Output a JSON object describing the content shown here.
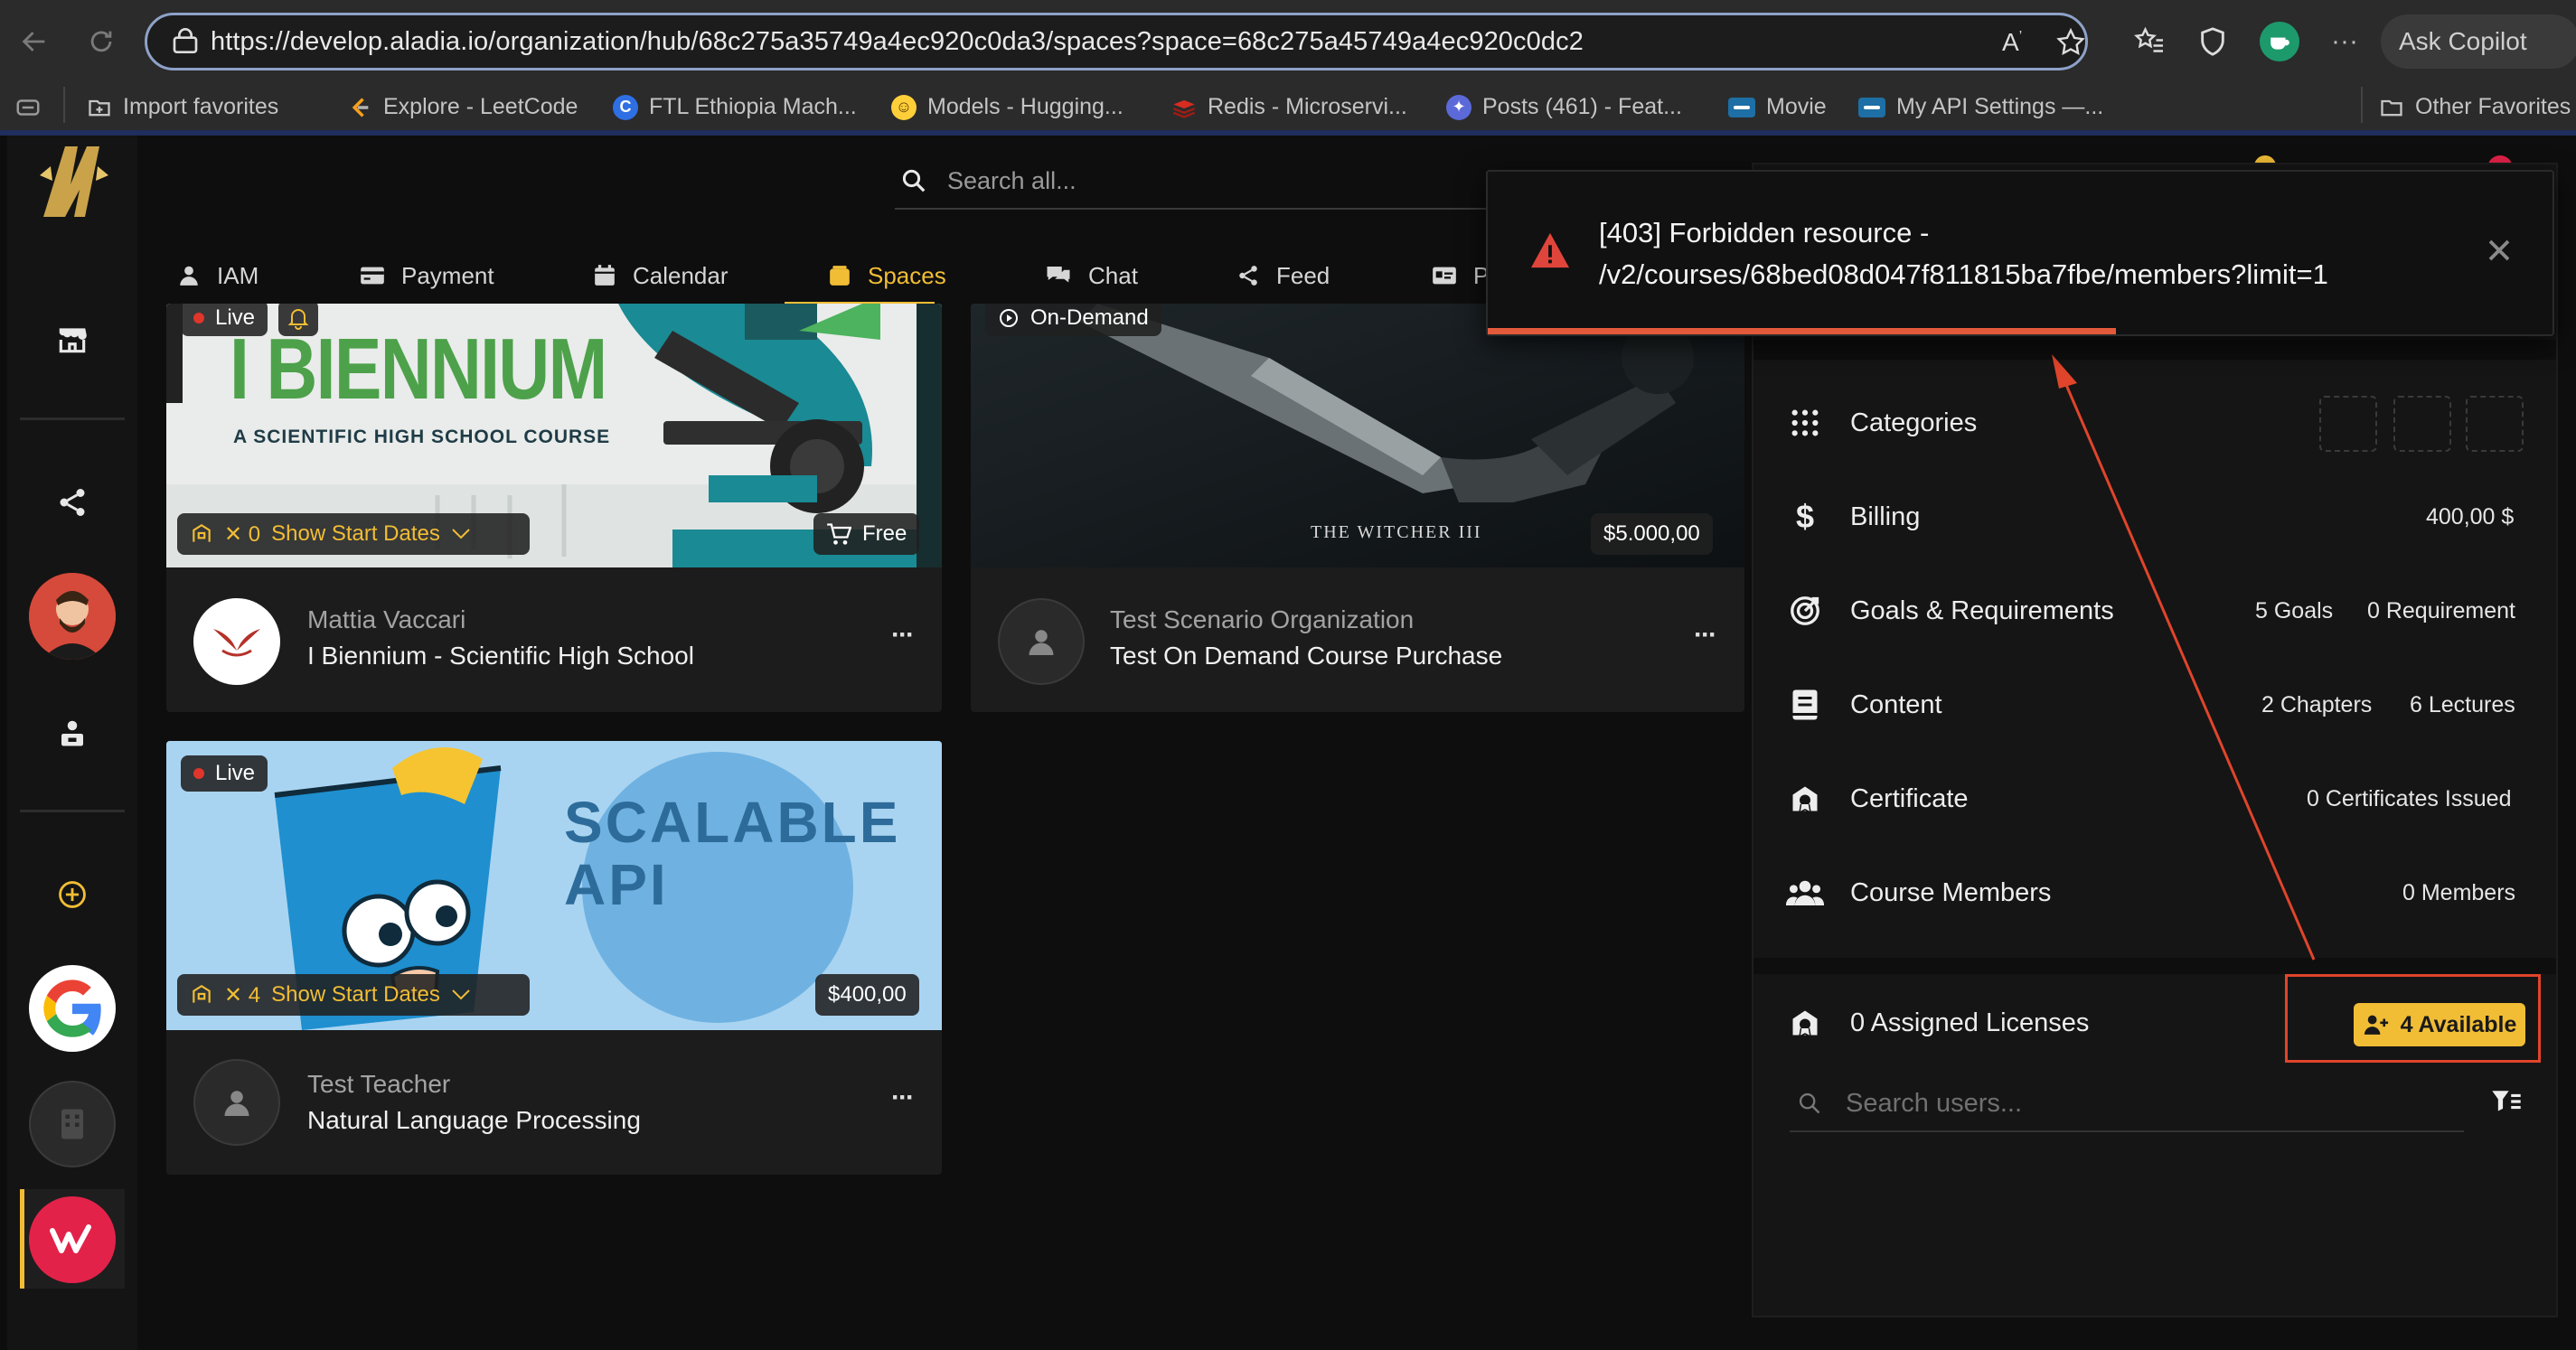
{
  "browser": {
    "url": "https://develop.aladia.io/organization/hub/68c275a35749a4ec920c0da3/spaces?space=68c275a45749a4ec920c0dc2",
    "copilot_label": "Ask Copilot",
    "bookmarks": [
      {
        "label": "Import favorites",
        "icon": "import-icon"
      },
      {
        "label": "Explore - LeetCode",
        "icon": "leetcode-icon",
        "color": "#f89f1b"
      },
      {
        "label": "FTL Ethiopia Mach...",
        "icon": "ftl-icon",
        "color": "#2f6fe4"
      },
      {
        "label": "Models - Hugging...",
        "icon": "huggingface-icon",
        "color": "#ffcf3a"
      },
      {
        "label": "Redis - Microservi...",
        "icon": "redis-icon",
        "color": "#d82c20"
      },
      {
        "label": "Posts (461) - Feat...",
        "icon": "posts-icon",
        "color": "#5b6ad8"
      },
      {
        "label": "Movie",
        "icon": "movie-icon",
        "color": "#1d6fa5"
      },
      {
        "label": "My API Settings —...",
        "icon": "api-settings-icon",
        "color": "#1d6fa5"
      }
    ],
    "other_favorites": "Other Favorites"
  },
  "app": {
    "search_placeholder": "Search all...",
    "nav_tabs": [
      {
        "label": "IAM",
        "icon": "user-icon"
      },
      {
        "label": "Payment",
        "icon": "card-icon"
      },
      {
        "label": "Calendar",
        "icon": "calendar-icon"
      },
      {
        "label": "Spaces",
        "icon": "spaces-icon",
        "active": true
      },
      {
        "label": "Chat",
        "icon": "chat-icon"
      },
      {
        "label": "Feed",
        "icon": "share-icon"
      },
      {
        "label": "P",
        "icon": "id-card-icon"
      }
    ],
    "accent_color": "#f1bd35"
  },
  "courses": [
    {
      "banner_heading": "I BIENNIUM",
      "banner_sub": "A SCIENTIFIC HIGH SCHOOL COURSE",
      "status": "Live",
      "licenses": "✕ 0",
      "dates_label": "Show Start Dates",
      "price": "Free",
      "org": "Mattia Vaccari",
      "title": "I Biennium - Scientific High School"
    },
    {
      "status": "On-Demand",
      "banner_mark": "THE WITCHER III",
      "price": "$5.000,00",
      "org": "Test Scenario Organization",
      "title": "Test On Demand Course Purchase"
    },
    {
      "banner_heading_1": "SCALABLE",
      "banner_heading_2": "API",
      "status": "Live",
      "licenses": "✕ 4",
      "dates_label": "Show Start Dates",
      "price": "$400,00",
      "org": "Test Teacher",
      "title": "Natural Language Processing"
    }
  ],
  "panel": {
    "categories_label": "Categories",
    "billing_label": "Billing",
    "billing_value": "400,00 $",
    "goals_label": "Goals & Requirements",
    "goals_value": "5 Goals",
    "requirements_value": "0 Requirement",
    "content_label": "Content",
    "chapters_value": "2 Chapters",
    "lectures_value": "6 Lectures",
    "certificate_label": "Certificate",
    "certificate_value": "0 Certificates Issued",
    "members_label": "Course Members",
    "members_value": "0 Members",
    "licenses_label": "0 Assigned Licenses",
    "available_label": "4 Available",
    "user_search_placeholder": "Search users..."
  },
  "toast": {
    "line1": "[403] Forbidden resource -",
    "line2": "/v2/courses/68bed08d047f811815ba7fbe/members?limit=1",
    "progress_fraction": 0.59,
    "color": "#e35a3b"
  }
}
